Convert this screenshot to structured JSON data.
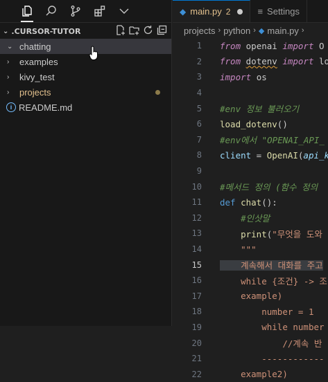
{
  "activity": {
    "icons": [
      "files-icon",
      "search-icon",
      "source-control-icon",
      "extensions-icon",
      "chevron-down-icon"
    ]
  },
  "explorer": {
    "title": ".CURSOR-TUTOR",
    "items": [
      {
        "label": "chatting",
        "selected": true
      },
      {
        "label": "examples"
      },
      {
        "label": "kivy_test"
      },
      {
        "label": "projects",
        "modified": true
      },
      {
        "label": "README.md",
        "info": true
      }
    ],
    "info_glyph": "i"
  },
  "tabs": [
    {
      "label": "main.py",
      "count": "2",
      "active": true
    },
    {
      "label": "Settings",
      "active": false
    }
  ],
  "breadcrumb": [
    "projects",
    "python",
    "main.py"
  ],
  "code": {
    "line_numbers": [
      "1",
      "2",
      "3",
      "4",
      "5",
      "6",
      "7",
      "8",
      "9",
      "10",
      "11",
      "12",
      "13",
      "14",
      "15",
      "16",
      "17",
      "18",
      "19",
      "20",
      "21",
      "22"
    ],
    "tokens": {
      "l1_from": "from",
      "l1_mod": "openai",
      "l1_import": "import",
      "l1_name": "O",
      "l2_from": "from",
      "l2_mod": "dotenv",
      "l2_import": "import",
      "l2_name": "lo",
      "l3_import": "import",
      "l3_mod": "os",
      "l5_cm": "#env 정보 불러오기",
      "l6_fn": "load_dotenv",
      "l6_rest": "()",
      "l7_cm": "#env에서 \"OPENAI_API_",
      "l8_var": "client",
      "l8_eq": " = ",
      "l8_fn": "OpenAI",
      "l8_rest": "(",
      "l8_arg": "api_k",
      "l10_cm": "#메서드 정의 (함수 정의",
      "l11_def": "def",
      "l11_fn": "chat",
      "l11_rest": "():",
      "l12_cm": "#인삿말",
      "l13_fn": "print",
      "l13_p": "(",
      "l13_str": "\"무엇을 도와",
      "l14_str": "\"\"\"",
      "l15_str": "계속해서 대화를 주고",
      "l16_str": "while {조건} -> 조",
      "l17_str": "example)",
      "l18_str": "number = 1",
      "l19_str": "while number",
      "l20_str": "//계속 반",
      "l21_str": "------------",
      "l22_str": "example2)"
    }
  }
}
